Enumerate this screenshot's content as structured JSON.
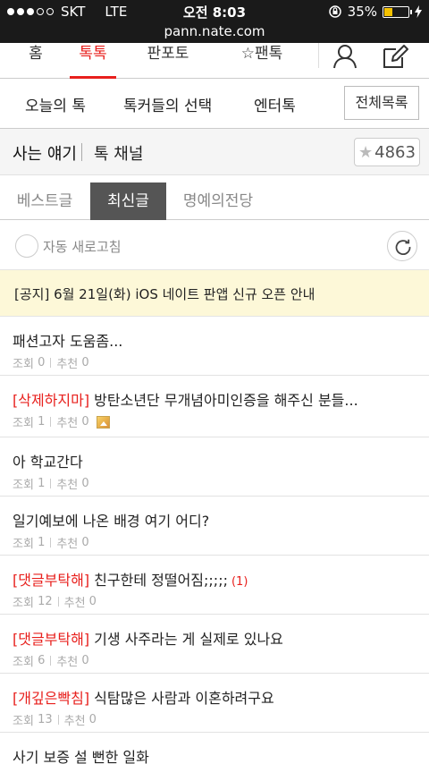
{
  "status": {
    "carrier": "SKT",
    "network": "LTE",
    "time": "오전 8:03",
    "battery": "35%",
    "battery_level": 0.35
  },
  "url": "pann.nate.com",
  "topnav": {
    "tabs": [
      "홈",
      "톡톡",
      "판포토",
      "팬톡"
    ],
    "active": "톡톡"
  },
  "subnav": {
    "items": [
      "오늘의 톡",
      "톡커들의 선택",
      "엔터톡"
    ],
    "all_button": "전체목록"
  },
  "channel": {
    "name": "사는 얘기",
    "sub": "톡 채널",
    "fav_count": "4863"
  },
  "board_tabs": {
    "tabs": [
      "베스트글",
      "최신글",
      "명예의전당"
    ],
    "active": "최신글"
  },
  "refresh": {
    "label": "자동 새로고침"
  },
  "notice": "[공지] 6월 21일(화) iOS 네이트 판앱 신규 오픈 안내",
  "posts": [
    {
      "tag": "",
      "title": "패션고자 도움좀...",
      "views_label": "조회",
      "views": "0",
      "recs_label": "추천",
      "recs": "0",
      "comments": "",
      "has_image": false
    },
    {
      "tag": "[삭제하지마]",
      "title": " 방탄소년단 무개념아미인증을 해주신 분들...",
      "views_label": "조회",
      "views": "1",
      "recs_label": "추천",
      "recs": "0",
      "comments": "",
      "has_image": true
    },
    {
      "tag": "",
      "title": "아 학교간다",
      "views_label": "조회",
      "views": "1",
      "recs_label": "추천",
      "recs": "0",
      "comments": "",
      "has_image": false
    },
    {
      "tag": "",
      "title": "일기예보에 나온 배경 여기 어디?",
      "views_label": "조회",
      "views": "1",
      "recs_label": "추천",
      "recs": "0",
      "comments": "",
      "has_image": false
    },
    {
      "tag": "[댓글부탁해]",
      "title": " 친구한테 정떨어짐;;;;;",
      "views_label": "조회",
      "views": "12",
      "recs_label": "추천",
      "recs": "0",
      "comments": "(1)",
      "has_image": false
    },
    {
      "tag": "[댓글부탁해]",
      "title": " 기생 사주라는 게 실제로 있나요",
      "views_label": "조회",
      "views": "6",
      "recs_label": "추천",
      "recs": "0",
      "comments": "",
      "has_image": false
    },
    {
      "tag": "[개깊은빡침]",
      "title": " 식탐많은 사람과 이혼하려구요",
      "views_label": "조회",
      "views": "13",
      "recs_label": "추천",
      "recs": "0",
      "comments": "",
      "has_image": false
    },
    {
      "tag": "",
      "title": "사기 보증 설 뻔한 일화",
      "views_label": "",
      "views": "",
      "recs_label": "",
      "recs": "",
      "comments": "",
      "has_image": false
    }
  ]
}
